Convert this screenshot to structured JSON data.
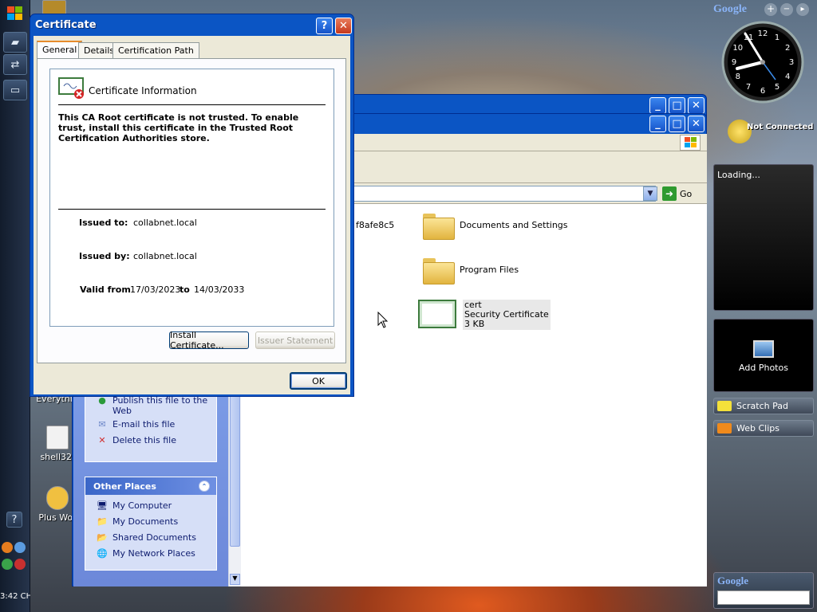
{
  "desktop": {
    "icons": [
      {
        "label": "Everythi"
      },
      {
        "label": "shell32."
      },
      {
        "label": "Plus Wor"
      }
    ]
  },
  "taskbar": {
    "clock": "3:42 CH"
  },
  "explorer": {
    "toolbar": {
      "go_label": "Go"
    },
    "files": [
      {
        "name": "f8afe8c5"
      },
      {
        "name": "Documents and Settings"
      },
      {
        "name": "Program Files"
      },
      {
        "name": "cert",
        "type": "Security Certificate",
        "size": "3 KB"
      }
    ],
    "file_tasks": [
      {
        "label": "Publish this file to the Web"
      },
      {
        "label": "E-mail this file"
      },
      {
        "label": "Delete this file"
      }
    ],
    "other_places": {
      "title": "Other Places",
      "items": [
        {
          "label": "My Computer"
        },
        {
          "label": "My Documents"
        },
        {
          "label": "Shared Documents"
        },
        {
          "label": "My Network Places"
        }
      ]
    }
  },
  "certificate": {
    "title": "Certificate",
    "tabs": [
      {
        "label": "General"
      },
      {
        "label": "Details"
      },
      {
        "label": "Certification Path"
      }
    ],
    "info_heading": "Certificate Information",
    "message": "This CA Root certificate is not trusted. To enable trust, install this certificate in the Trusted Root Certification Authorities store.",
    "issued_to_label": "Issued to:",
    "issued_to": "collabnet.local",
    "issued_by_label": "Issued by:",
    "issued_by": "collabnet.local",
    "valid_from_label": "Valid from",
    "valid_from": "17/03/2023",
    "to_label": "to",
    "valid_to": "14/03/2033",
    "install_button": "Install Certificate...",
    "issuer_button": "Issuer Statement",
    "ok_button": "OK"
  },
  "google_sidebar": {
    "logo": "Google",
    "status": "Not Connected",
    "loading": "Loading...",
    "add_photos": "Add Photos",
    "scratch_pad": "Scratch Pad",
    "web_clips": "Web Clips",
    "search_logo": "Google",
    "clock_numbers": [
      "12",
      "1",
      "2",
      "3",
      "4",
      "5",
      "6",
      "7",
      "8",
      "9",
      "10",
      "11"
    ]
  },
  "colors": {
    "xp_blue": "#0b55c4",
    "close_red": "#e04a2a",
    "task_blue": "#215dc6"
  }
}
